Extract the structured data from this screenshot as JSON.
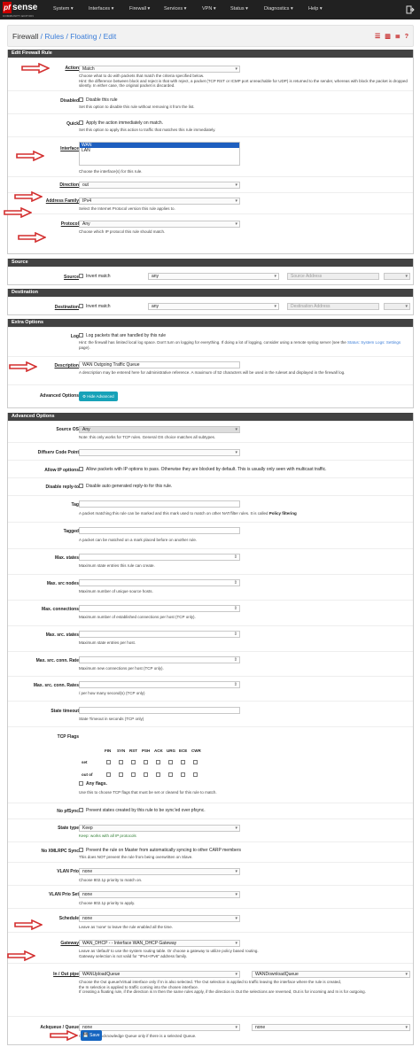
{
  "navbar": {
    "logo_main": "sense",
    "logo_pf": "pf",
    "logo_sub": "COMMUNITY EDITION",
    "items": [
      "System ▾",
      "Interfaces ▾",
      "Firewall ▾",
      "Services ▾",
      "VPN ▾",
      "Status ▾",
      "Diagnostics ▾",
      "Help ▾"
    ],
    "right_icon": "logout-icon"
  },
  "breadcrumb": {
    "part1": "Firewall",
    "part2": "Rules",
    "part3": "Floating",
    "part4": "Edit",
    "sep": "/"
  },
  "sections": {
    "edit": "Edit Firewall Rule",
    "source": "Source",
    "destination": "Destination",
    "extra": "Extra Options",
    "advanced": "Advanced Options"
  },
  "edit": {
    "action_label": "Action",
    "action_value": "Match",
    "action_help": "Choose what to do with packets that match the criteria specified below.",
    "action_hint": "Hint: the difference between block and reject is that with reject, a packet (TCP RST or ICMP port unreachable for UDP) is returned to the sender, whereas with block the packet is dropped silently. In either case, the original packet is discarded.",
    "disabled_label": "Disabled",
    "disabled_cb": "Disable this rule",
    "disabled_help": "Set this option to disable this rule without removing it from the list.",
    "quick_label": "Quick",
    "quick_cb": "Apply the action immediately on match.",
    "quick_help": "Set this option to apply this action to traffic that matches this rule immediately.",
    "interface_label": "Interface",
    "interface_options": [
      "WAN",
      "LAN"
    ],
    "interface_help": "Choose the interface(s) for this rule.",
    "direction_label": "Direction",
    "direction_value": "out",
    "family_label": "Address Family",
    "family_value": "IPv4",
    "family_help": "Select the Internet Protocol version this rule applies to.",
    "protocol_label": "Protocol",
    "protocol_value": "Any",
    "protocol_help": "Choose which IP protocol this rule should match."
  },
  "source": {
    "label": "Source",
    "invert": "Invert match",
    "value": "any",
    "addr_placeholder": "Source Address"
  },
  "destination": {
    "label": "Destination",
    "invert": "Invert match",
    "value": "any",
    "addr_placeholder": "Destination Address"
  },
  "extra": {
    "log_label": "Log",
    "log_cb": "Log packets that are handled by this rule",
    "log_hint_prefix": "Hint: the firewall has limited local log space. Don't turn on logging for everything. If doing a lot of logging, consider using a remote syslog server (see the",
    "log_hint_link": "Status: System Logs: Settings",
    "log_hint_suffix": "page).",
    "desc_label": "Description",
    "desc_value": "WAN Outgoing Traffic Queue",
    "desc_help": "A description may be entered here for administrative reference. A maximum of 52 characters will be used in the ruleset and displayed in the firewall log.",
    "adv_label": "Advanced Options",
    "adv_button": "Hide Advanced"
  },
  "advanced": {
    "sourceos_label": "Source OS",
    "sourceos_value": "Any",
    "sourceos_help": "Note: this only works for TCP rules. General OS choice matches all subtypes.",
    "diffserv_label": "Diffserv Code Point",
    "allowip_label": "Allow IP options",
    "allowip_cb": "Allow packets with IP options to pass. Otherwise they are blocked by default. This is usually only seen with multicast traffic.",
    "disreply_label": "Disable reply-to",
    "disreply_cb": "Disable auto generated reply-to for this rule.",
    "tag_label": "Tag",
    "tag_help_prefix": "A packet matching this rule can be marked and this mark used to match on other NAT/filter rules. It is called",
    "tag_help_bold": "Policy filtering",
    "tagged_label": "Tagged",
    "tagged_help": "A packet can be matched on a mark placed before on another rule.",
    "maxstates_label": "Max. states",
    "maxstates_help": "Maximum state entries this rule can create.",
    "maxsrc_label": "Max. src nodes",
    "maxsrc_help": "Maximum number of unique source hosts.",
    "maxconn_label": "Max. connections",
    "maxconn_help": "Maximum number of established connections per host (TCP only).",
    "maxsrcstates_label": "Max. src. states",
    "maxsrcstates_help": "Maximum state entries per host.",
    "maxsrcconn_label": "Max. src. conn. Rate",
    "maxsrcconn_help": "Maximum new connections per host (TCP only).",
    "maxsrcrates_label": "Max. src. conn. Rates",
    "maxsrcrates_help": "/ per how many second(s) (TCP only)",
    "statetimeout_label": "State timeout",
    "statetimeout_help": "State Timeout in seconds (TCP only)",
    "tcpflags_label": "TCP Flags",
    "flags": [
      "FIN",
      "SYN",
      "RST",
      "PSH",
      "ACK",
      "URG",
      "ECE",
      "CWR"
    ],
    "flags_set": "set",
    "flags_outof": "out of",
    "anyflags": "Any flags.",
    "flags_help": "Use this to choose TCP flags that must be set or cleared for this rule to match.",
    "nopfsync_label": "No pfSync",
    "nopfsync_cb": "Prevent states created by this rule to be sync'ed over pfsync.",
    "statetype_label": "State type",
    "statetype_value": "Keep",
    "statetype_help": "Keep: works with all IP protocols",
    "noxmlrpc_label": "No XMLRPC Sync",
    "noxmlrpc_cb": "Prevent the rule on Master from automatically syncing to other CARP members",
    "noxmlrpc_help": "This does NOT prevent the rule from being overwritten on Slave.",
    "vlanprio_label": "VLAN Prio",
    "vlanprio_value": "none",
    "vlanprio_help": "Choose 802.1p priority to match on.",
    "vlanprioset_label": "VLAN Prio Set",
    "vlanprioset_value": "none",
    "vlanprioset_help": "Choose 802.1p priority to apply.",
    "schedule_label": "Schedule",
    "schedule_value": "none",
    "schedule_help": "Leave as 'none' to leave the rule enabled all the time.",
    "gateway_label": "Gateway",
    "gateway_value": "WAN_DHCP -                             - Interface WAN_DHCP Gateway",
    "gateway_help1": "Leave as 'default' to use the system routing table. Or choose a gateway to utilize policy based routing.",
    "gateway_help2": "Gateway selection is not valid for \"IPv4+IPv6\" address family.",
    "pipe_label": "In / Out pipe",
    "pipe_in": "WANUploadQueue",
    "pipe_out": "WANDownloadQueue",
    "pipe_help1": "Choose the Out queue/Virtual interface only if In is also selected. The Out selection is applied to traffic leaving the interface where the rule is created,",
    "pipe_help2": "the In selection is applied to traffic coming into the chosen interface.",
    "pipe_help3": "If creating a floating rule, if the direction is In then the same rules apply, if the direction is Out the selections are reversed, Out is for incoming and In is for outgoing.",
    "ackq_label": "Ackqueue / Queue",
    "ackq_value": "none",
    "queue_value": "none",
    "ackq_help": "Choose the Acknowledge Queue only if there is a selected Queue."
  },
  "save_button": "Save",
  "colors": {
    "navbar": "#212121",
    "section_header": "#424242",
    "arrow": "#d32f2f",
    "link": "#3b7dd8",
    "save": "#1565c0"
  }
}
